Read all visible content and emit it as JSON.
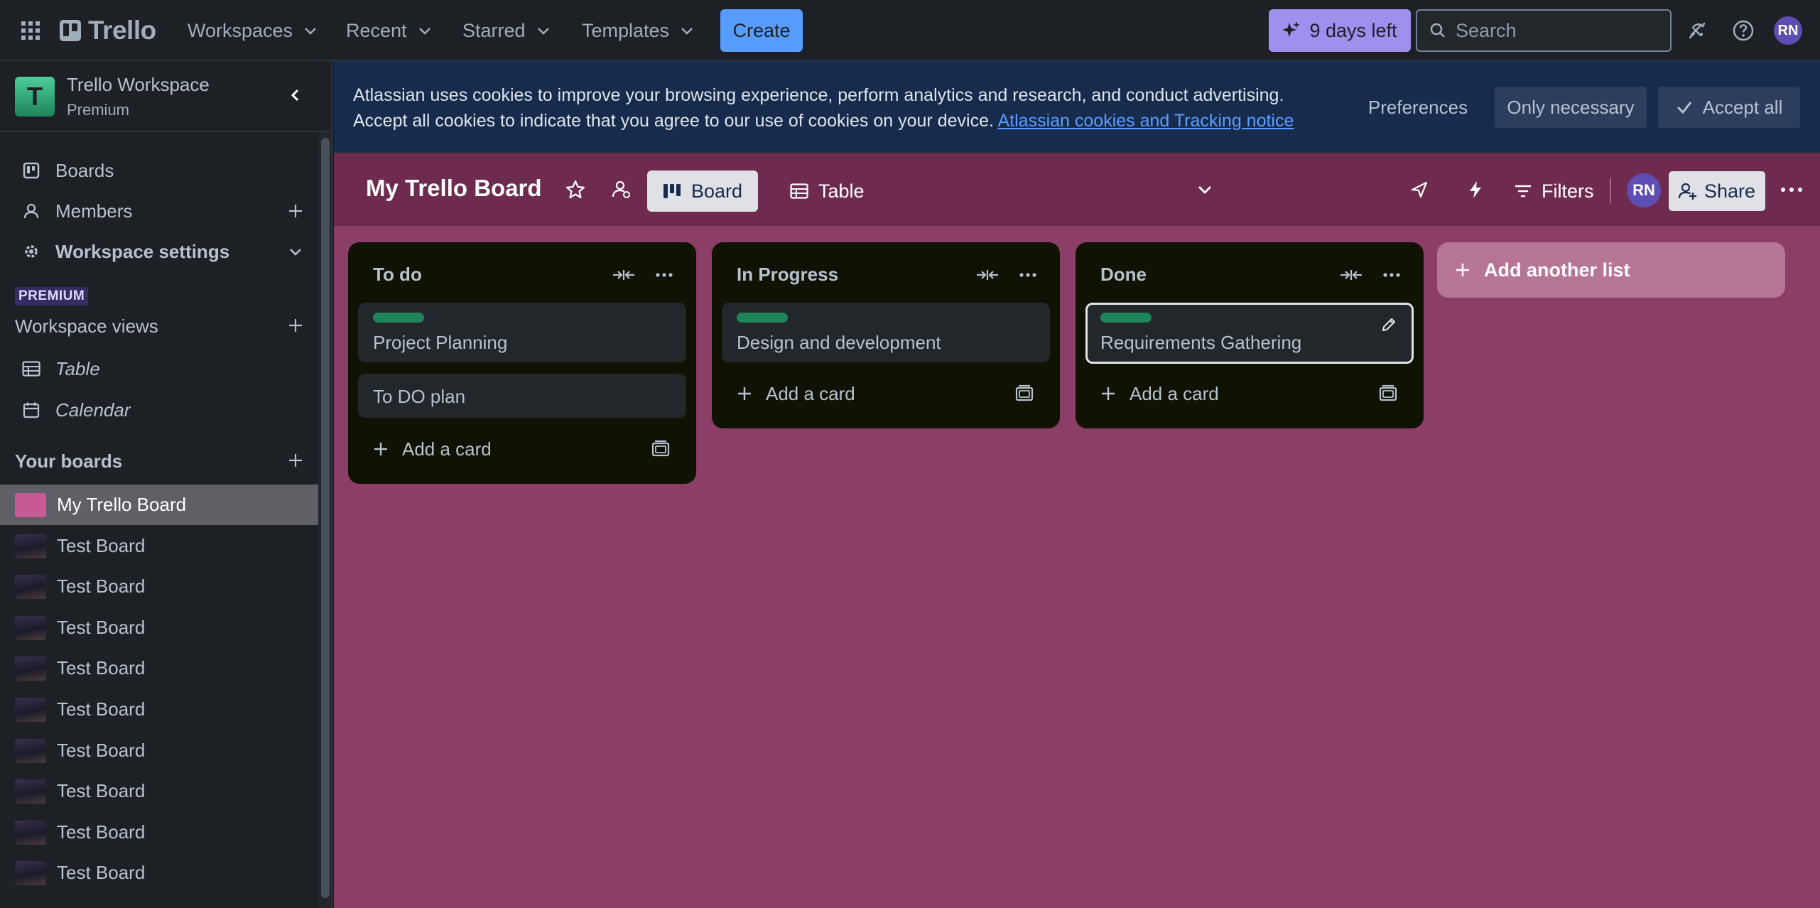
{
  "topbar": {
    "brand": "Trello",
    "nav": [
      {
        "label": "Workspaces"
      },
      {
        "label": "Recent"
      },
      {
        "label": "Starred"
      },
      {
        "label": "Templates"
      }
    ],
    "create_label": "Create",
    "trial_label": "9 days left",
    "search_placeholder": "Search",
    "user_initials": "RN"
  },
  "sidebar": {
    "workspace_initial": "T",
    "workspace_name": "Trello Workspace",
    "workspace_plan": "Premium",
    "items": [
      {
        "label": "Boards",
        "icon": "board-icon"
      },
      {
        "label": "Members",
        "icon": "person-icon"
      },
      {
        "label": "Workspace settings",
        "icon": "gear-icon"
      }
    ],
    "premium_badge": "PREMIUM",
    "views_title": "Workspace views",
    "views": [
      {
        "label": "Table",
        "icon": "table-icon"
      },
      {
        "label": "Calendar",
        "icon": "calendar-icon"
      }
    ],
    "boards_title": "Your boards",
    "boards": [
      {
        "label": "My Trello Board",
        "active": true
      },
      {
        "label": "Test Board"
      },
      {
        "label": "Test Board"
      },
      {
        "label": "Test Board"
      },
      {
        "label": "Test Board"
      },
      {
        "label": "Test Board"
      },
      {
        "label": "Test Board"
      },
      {
        "label": "Test Board"
      },
      {
        "label": "Test Board"
      },
      {
        "label": "Test Board"
      }
    ]
  },
  "cookie": {
    "line1": "Atlassian uses cookies to improve your browsing experience, perform analytics and research, and conduct advertising.",
    "line2": "Accept all cookies to indicate that you agree to our use of cookies on your device.",
    "link": "Atlassian cookies and Tracking notice",
    "preferences": "Preferences",
    "only_necessary": "Only necessary",
    "accept_all": "Accept all"
  },
  "board": {
    "title": "My Trello Board",
    "views": [
      {
        "label": "Board"
      },
      {
        "label": "Table"
      }
    ],
    "filters_label": "Filters",
    "member_initials": "RN",
    "share_label": "Share",
    "lists": [
      {
        "title": "To do",
        "cards": [
          {
            "text": "Project Planning",
            "label_color": "#1f845a"
          },
          {
            "text": "To DO plan"
          }
        ],
        "add_card": "Add a card"
      },
      {
        "title": "In Progress",
        "cards": [
          {
            "text": "Design and development",
            "label_color": "#1f845a"
          }
        ],
        "add_card": "Add a card"
      },
      {
        "title": "Done",
        "cards": [
          {
            "text": "Requirements Gathering",
            "label_color": "#1f845a"
          }
        ],
        "add_card": "Add a card"
      }
    ],
    "add_list": "Add another list"
  },
  "colors": {
    "board_bg": "#8b3f66",
    "header_bg": "#6f2b4f",
    "accent": "#579dff",
    "trial": "#9f8fef",
    "label_green": "#1f845a"
  }
}
